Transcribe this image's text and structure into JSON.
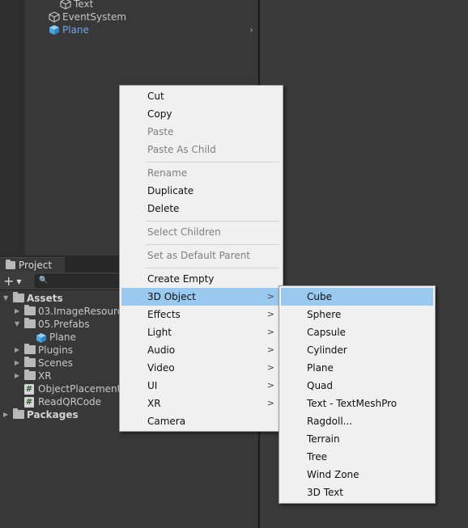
{
  "hierarchy": {
    "items": [
      {
        "label": "Text"
      },
      {
        "label": "EventSystem"
      },
      {
        "label": "Plane",
        "selected": true
      }
    ],
    "expand_arrow": "chevron-right-icon"
  },
  "project": {
    "tab_label": "Project",
    "add_button": "+",
    "search_placeholder": "",
    "tree": [
      {
        "label": "Assets",
        "expanded": true,
        "bold": true,
        "icon": "folder-open-icon"
      },
      {
        "label": "03.ImageResource",
        "icon": "folder-icon"
      },
      {
        "label": "05.Prefabs",
        "expanded": true,
        "icon": "folder-open-icon"
      },
      {
        "label": "Plane",
        "icon": "prefab-cube-icon"
      },
      {
        "label": "Plugins",
        "icon": "folder-icon"
      },
      {
        "label": "Scenes",
        "icon": "folder-icon"
      },
      {
        "label": "XR",
        "icon": "folder-icon"
      },
      {
        "label": "ObjectPlacement",
        "icon": "csharp-script-icon"
      },
      {
        "label": "ReadQRCode",
        "icon": "csharp-script-icon"
      },
      {
        "label": "Packages",
        "bold": true,
        "icon": "folder-icon"
      }
    ]
  },
  "context_menu": {
    "items": [
      {
        "label": "Cut",
        "enabled": true
      },
      {
        "label": "Copy",
        "enabled": true
      },
      {
        "label": "Paste",
        "enabled": false
      },
      {
        "label": "Paste As Child",
        "enabled": false
      },
      {
        "label": "Rename",
        "enabled": false
      },
      {
        "label": "Duplicate",
        "enabled": true
      },
      {
        "label": "Delete",
        "enabled": true
      },
      {
        "label": "Select Children",
        "enabled": false
      },
      {
        "label": "Set as Default Parent",
        "enabled": false
      },
      {
        "label": "Create Empty",
        "enabled": true
      },
      {
        "label": "3D Object",
        "enabled": true,
        "submenu": true,
        "highlighted": true
      },
      {
        "label": "Effects",
        "enabled": true,
        "submenu": true
      },
      {
        "label": "Light",
        "enabled": true,
        "submenu": true
      },
      {
        "label": "Audio",
        "enabled": true,
        "submenu": true
      },
      {
        "label": "Video",
        "enabled": true,
        "submenu": true
      },
      {
        "label": "UI",
        "enabled": true,
        "submenu": true
      },
      {
        "label": "XR",
        "enabled": true,
        "submenu": true
      },
      {
        "label": "Camera",
        "enabled": true
      }
    ],
    "submenu_arrow": ">"
  },
  "submenu_3d_object": {
    "items": [
      {
        "label": "Cube",
        "highlighted": true
      },
      {
        "label": "Sphere"
      },
      {
        "label": "Capsule"
      },
      {
        "label": "Cylinder"
      },
      {
        "label": "Plane"
      },
      {
        "label": "Quad"
      },
      {
        "label": "Text - TextMeshPro"
      },
      {
        "label": "Ragdoll..."
      },
      {
        "label": "Terrain"
      },
      {
        "label": "Tree"
      },
      {
        "label": "Wind Zone"
      },
      {
        "label": "3D Text"
      }
    ]
  },
  "colors": {
    "menu_bg": "#f0f0f0",
    "menu_highlight": "#99c9ef",
    "selected_text": "#6fa6e8",
    "editor_bg": "#383838"
  }
}
